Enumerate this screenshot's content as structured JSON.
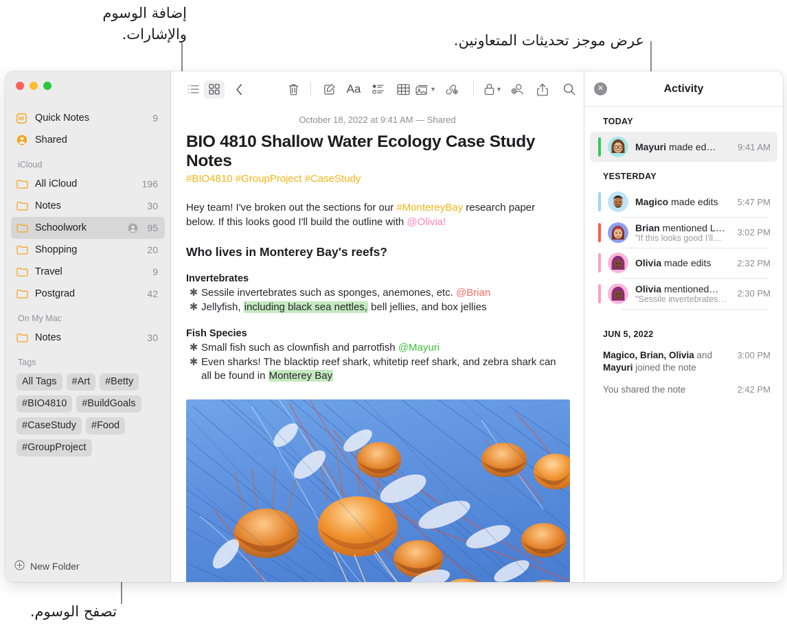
{
  "annotations": [
    {
      "id": "add-tags",
      "text": "إضافة الوسوم\nوالإشارات."
    },
    {
      "id": "collaborator-updates",
      "text": "عرض موجز تحديثات المتعاونين."
    },
    {
      "id": "browse-tags",
      "text": "تصفح الوسوم."
    }
  ],
  "sidebar": {
    "pinned": [
      {
        "label": "Quick Notes",
        "count": "9",
        "icon": "quick-note-icon"
      },
      {
        "label": "Shared",
        "count": "",
        "icon": "shared-person-icon"
      }
    ],
    "sections": [
      {
        "title": "iCloud",
        "items": [
          {
            "label": "All iCloud",
            "count": "196",
            "icon": "folder-icon",
            "selected": false,
            "shared": false
          },
          {
            "label": "Notes",
            "count": "30",
            "icon": "folder-icon",
            "selected": false,
            "shared": false
          },
          {
            "label": "Schoolwork",
            "count": "95",
            "icon": "folder-icon",
            "selected": true,
            "shared": true
          },
          {
            "label": "Shopping",
            "count": "20",
            "icon": "folder-icon",
            "selected": false,
            "shared": false
          },
          {
            "label": "Travel",
            "count": "9",
            "icon": "folder-icon",
            "selected": false,
            "shared": false
          },
          {
            "label": "Postgrad",
            "count": "42",
            "icon": "folder-icon",
            "selected": false,
            "shared": false
          }
        ]
      },
      {
        "title": "On My Mac",
        "items": [
          {
            "label": "Notes",
            "count": "30",
            "icon": "folder-icon",
            "selected": false,
            "shared": false
          }
        ]
      }
    ],
    "tags_title": "Tags",
    "tags": [
      "All Tags",
      "#Art",
      "#Betty",
      "#BIO4810",
      "#BuildGoals",
      "#CaseStudy",
      "#Food",
      "#GroupProject"
    ],
    "new_folder_label": "New Folder"
  },
  "toolbar": {
    "list_view": "list-view-icon",
    "gallery_view": "gallery-view-icon",
    "back": "back-chevron-icon",
    "delete": "trash-icon",
    "compose": "compose-note-icon",
    "format": "Aa",
    "checklist": "checklist-icon",
    "table": "table-icon",
    "media": "media-icon",
    "link": "link-icon",
    "lock": "lock-icon",
    "add_people": "add-person-icon",
    "share": "share-icon",
    "search": "search-icon"
  },
  "note": {
    "date": "October 18, 2022 at 9:41 AM — Shared",
    "title": "BIO 4810 Shallow Water Ecology Case Study Notes",
    "tags_line": "#BIO4810 #GroupProject #CaseStudy",
    "intro": {
      "p1": "Hey team! I've broken out the sections for our ",
      "tag1": "#MontereyBay",
      "p2": " research paper below. If this looks good I'll build the outline with ",
      "mention1": "@Olivia!"
    },
    "heading": "Who lives in Monterey Bay's reefs?",
    "sub1": "Invertebrates",
    "b1": {
      "pre": "Sessile invertebrates such as sponges, anemones, etc. ",
      "mention": "@Brian"
    },
    "b2": {
      "pre": "Jellyfish, ",
      "hl": "including black sea nettles,",
      "post": " bell jellies, and box jellies"
    },
    "sub2": "Fish Species",
    "b3": {
      "pre": "Small fish such as clownfish and parrotfish ",
      "mention": "@Mayuri"
    },
    "b4": {
      "pre": "Even sharks! The blacktip reef shark, whitetip reef shark, and zebra shark can all be found in ",
      "hl": "Monterey Bay"
    },
    "image_alt": "jellyfish-photo"
  },
  "activity": {
    "close_icon": "close-icon",
    "title": "Activity",
    "groups": [
      {
        "title": "TODAY",
        "items": [
          {
            "name": "Mayuri",
            "action": " made ed…",
            "detail": "",
            "time": "9:41 AM",
            "bar_color": "#34c759",
            "highlight": true,
            "avatar_bg": "#a9e6e6",
            "hair": "#6b4226",
            "skin": "#e8b48c",
            "glasses": true
          }
        ]
      },
      {
        "title": "YESTERDAY",
        "items": [
          {
            "name": "Magico",
            "action": " made edits",
            "detail": "",
            "time": "5:47 PM",
            "bar_color": "#a3d4f5",
            "highlight": false,
            "avatar_bg": "#bfe3f7",
            "hair": "#2f2a25",
            "skin": "#b8784a",
            "glasses": false
          },
          {
            "name": "Brian",
            "action": " mentioned L…",
            "detail": "\"If this looks good I'll…",
            "time": "3:02 PM",
            "bar_color": "#ff5b4a",
            "highlight": false,
            "avatar_bg": "#8e9ef0",
            "hair": "#b03a3a",
            "skin": "#e8b48c",
            "glasses": false
          },
          {
            "name": "Olivia",
            "action": " made edits",
            "detail": "",
            "time": "2:32 PM",
            "bar_color": "#ff9ec4",
            "highlight": false,
            "avatar_bg": "#f9b6d9",
            "hair": "#8e2a7a",
            "skin": "#7a4a33",
            "glasses": false
          },
          {
            "name": "Olivia",
            "action": " mentioned…",
            "detail": "\"Sessile invertebrates…",
            "time": "2:30 PM",
            "bar_color": "#ff9ec4",
            "highlight": false,
            "avatar_bg": "#f9b6d9",
            "hair": "#8e2a7a",
            "skin": "#7a4a33",
            "glasses": false
          }
        ]
      }
    ],
    "older_title": "JUN 5, 2022",
    "older": [
      {
        "bold1": "Magico, Brian, Olivia",
        "mid": " and ",
        "bold2": "Mayuri",
        "tail": " joined the note",
        "time": "3:00 PM"
      },
      {
        "bold1": "",
        "mid": "",
        "bold2": "",
        "tail": "You shared the note",
        "time": "2:42 PM"
      }
    ]
  },
  "colors": {
    "accent_yellow": "#f5b517",
    "highlight_green": "#c4e9c0",
    "sidebar_bg": "#ececec",
    "selected_row": "#d7d7d7"
  }
}
